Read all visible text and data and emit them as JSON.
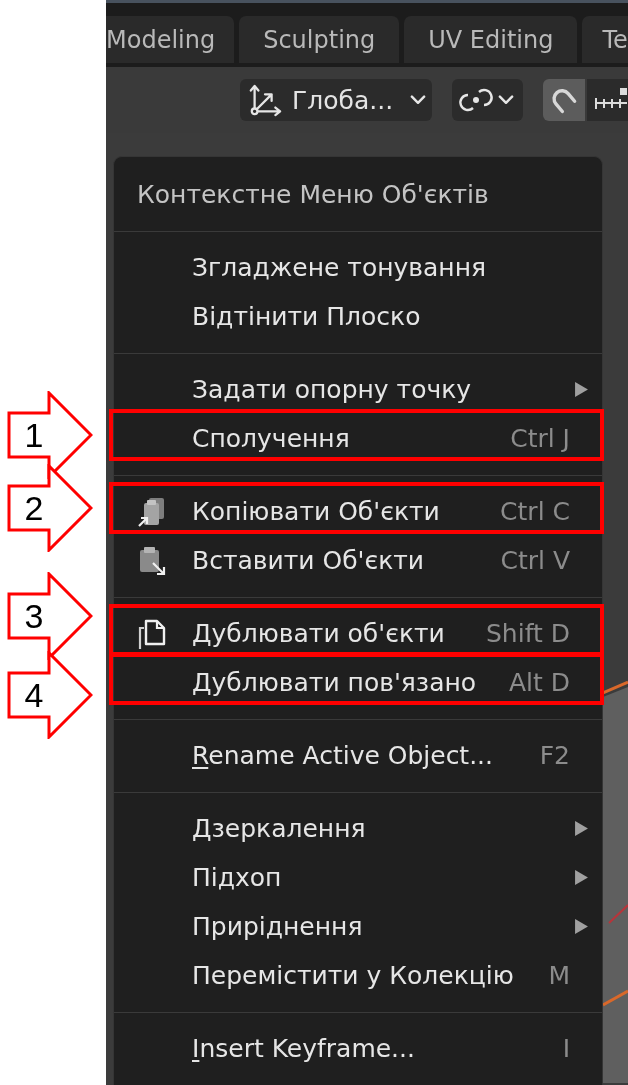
{
  "tabs": [
    {
      "label": "Modeling",
      "selected": false
    },
    {
      "label": "Sculpting",
      "selected": false
    },
    {
      "label": "UV Editing",
      "selected": false
    },
    {
      "label": "Te",
      "selected": false
    }
  ],
  "header": {
    "orientation": {
      "label": "Глоба..."
    },
    "snap": {
      "on": true
    }
  },
  "context_menu": {
    "title": "Контекстне Меню Об'єктів",
    "sections": [
      {
        "items": [
          {
            "kind": "plain",
            "label": "Згладжене тонування",
            "submenu": false,
            "mnemonic": false
          },
          {
            "kind": "plain",
            "label": "Відтінити Плоско",
            "submenu": false,
            "mnemonic": false
          }
        ]
      },
      {
        "items": [
          {
            "kind": "plain",
            "label": "Задати опорну точку",
            "submenu": true,
            "mnemonic": false
          },
          {
            "kind": "plain",
            "label": "Сполучення",
            "shortcut": "Ctrl J",
            "submenu": false,
            "mnemonic": false,
            "callout": {
              "number": "1"
            }
          }
        ]
      },
      {
        "items": [
          {
            "kind": "copy",
            "label": "Копіювати Об'єкти",
            "shortcut": "Ctrl C",
            "submenu": false,
            "mnemonic": false,
            "callout": {
              "number": "2"
            }
          },
          {
            "kind": "paste",
            "label": "Вставити Об'єкти",
            "shortcut": "Ctrl V",
            "submenu": false,
            "mnemonic": false
          }
        ]
      },
      {
        "items": [
          {
            "kind": "duplicate",
            "label": "Дублювати об'єкти",
            "shortcut": "Shift D",
            "submenu": false,
            "mnemonic": false,
            "callout": {
              "number": "3"
            }
          },
          {
            "kind": "plain",
            "label": "Дублювати пов'язано",
            "shortcut": "Alt D",
            "submenu": false,
            "mnemonic": false,
            "callout": {
              "number": "4"
            }
          }
        ]
      },
      {
        "items": [
          {
            "kind": "plain",
            "label": "Rename Active Object...",
            "shortcut": "F2",
            "submenu": false,
            "mnemonic": true
          }
        ]
      },
      {
        "items": [
          {
            "kind": "plain",
            "label": "Дзеркалення",
            "submenu": true,
            "mnemonic": false
          },
          {
            "kind": "plain",
            "label": "Підхоп",
            "submenu": true,
            "mnemonic": false
          },
          {
            "kind": "plain",
            "label": "Приріднення",
            "submenu": true,
            "mnemonic": false
          },
          {
            "kind": "plain",
            "label": "Перемістити у Колекцію",
            "shortcut": "M",
            "submenu": false,
            "mnemonic": false
          }
        ]
      },
      {
        "items": [
          {
            "kind": "plain",
            "label": "Insert Keyframe...",
            "shortcut": "I",
            "submenu": false,
            "mnemonic": true
          }
        ]
      }
    ]
  }
}
